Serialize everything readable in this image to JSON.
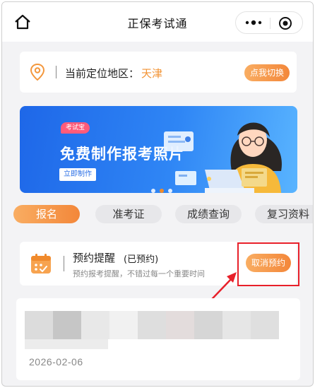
{
  "header": {
    "title": "正保考试通"
  },
  "location": {
    "label": "当前定位地区：",
    "city": "天津",
    "switch_label": "点我切换"
  },
  "banner": {
    "tag": "考试宝",
    "title": "免费制作报考照片",
    "button": "立即制作",
    "slide_count": 3,
    "active_slide": 2
  },
  "tabs": [
    {
      "label": "报名",
      "active": true
    },
    {
      "label": "准考证",
      "active": false
    },
    {
      "label": "成绩查询",
      "active": false
    },
    {
      "label": "复习资料",
      "active": false
    }
  ],
  "reminder": {
    "title": "预约提醒",
    "status": "(已预约)",
    "description": "预约报考提醒，不错过每一个重要时间",
    "cancel_label": "取消预约"
  },
  "item": {
    "date": "2026-02-06"
  },
  "colors": {
    "accent": "#f3873a",
    "annotation": "#e8202a",
    "banner": "#2f86f5"
  }
}
